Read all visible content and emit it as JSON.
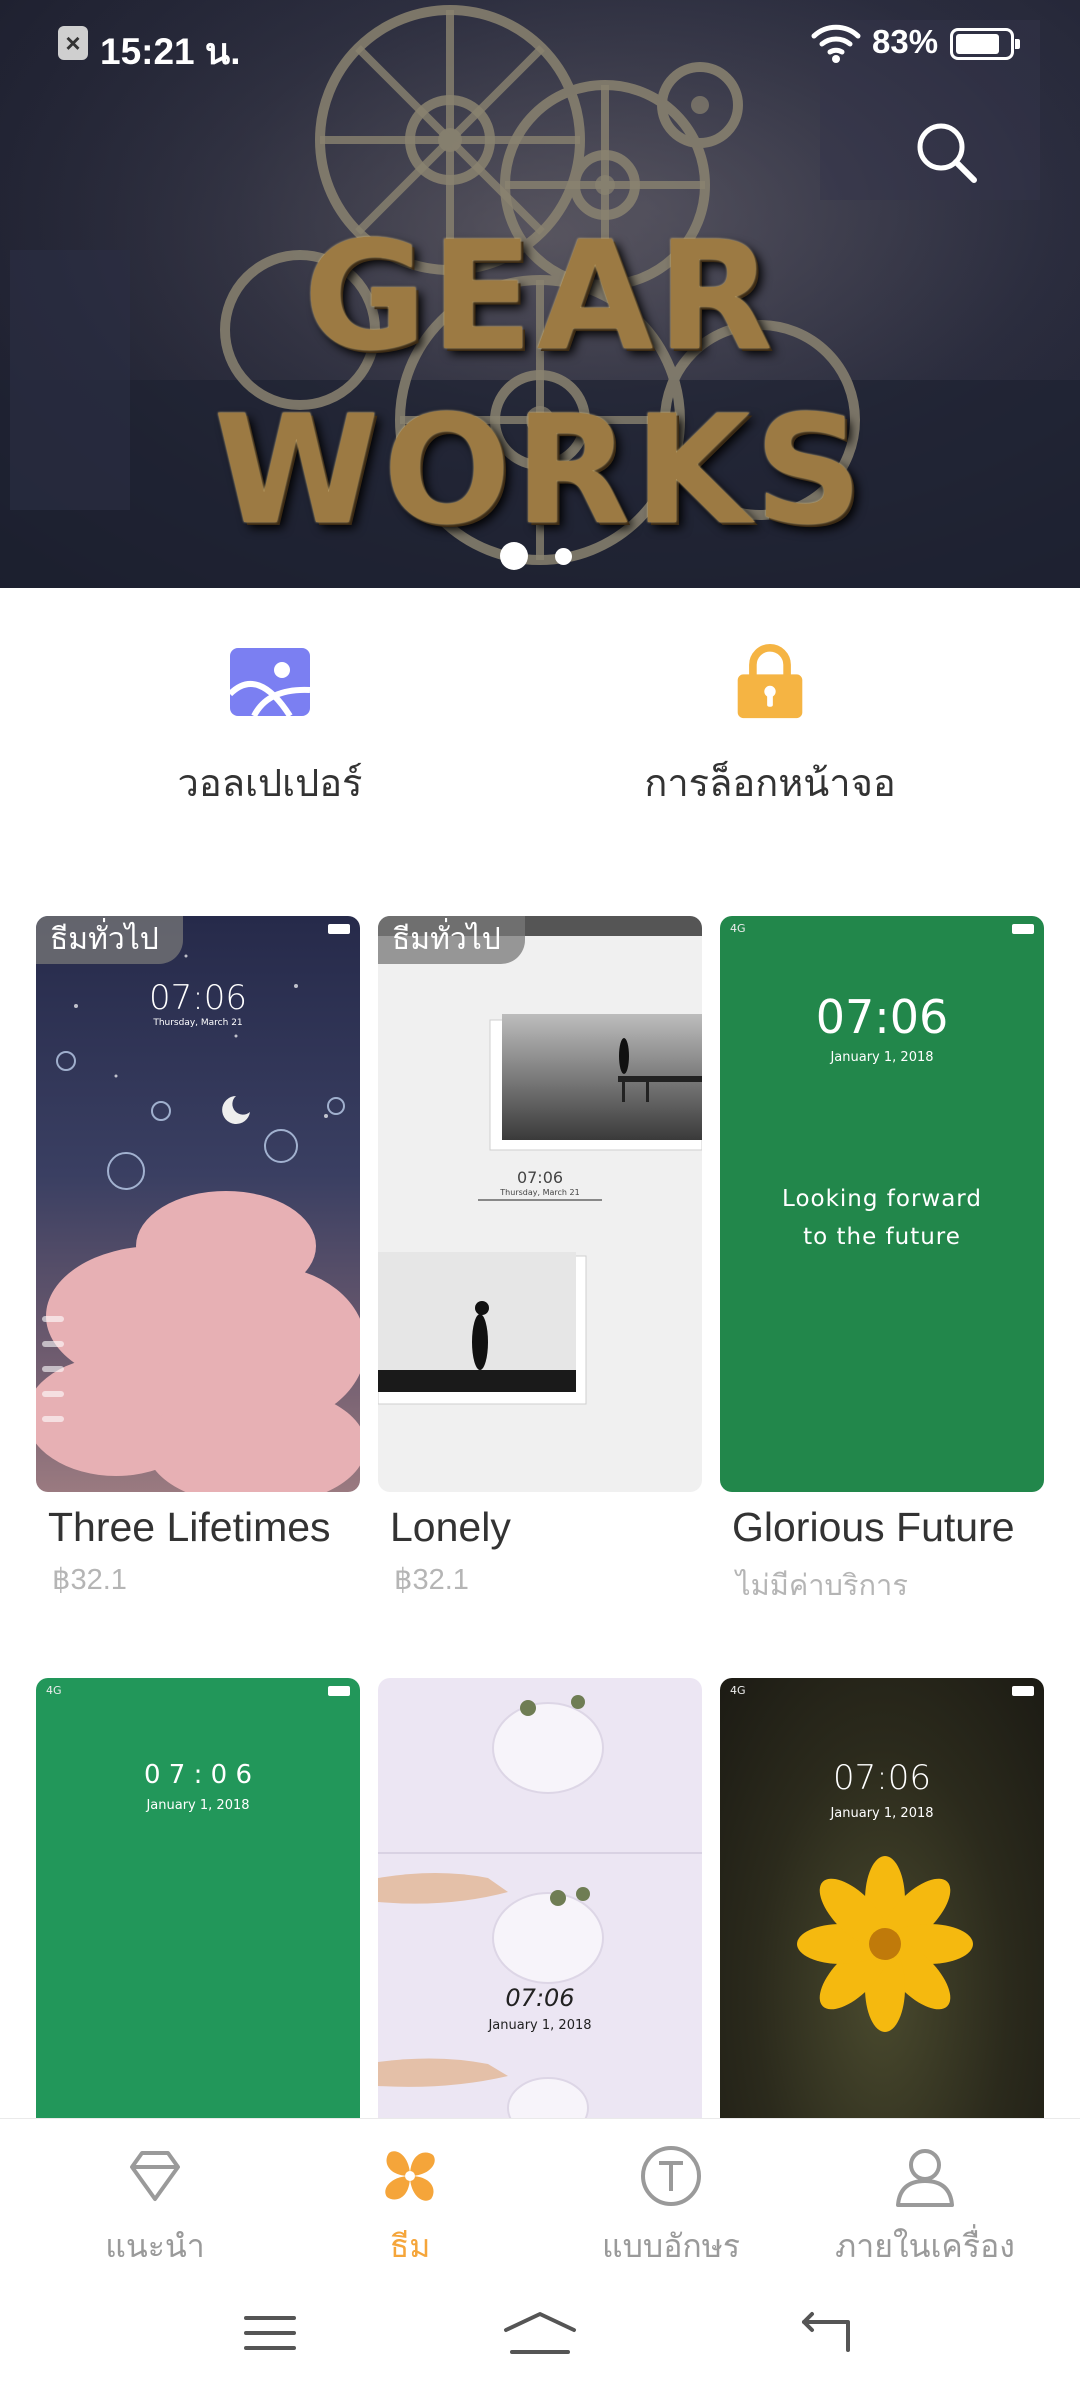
{
  "status_bar": {
    "time": "15:21 น.",
    "battery_percent": "83%",
    "battery_level": 0.83,
    "icons": [
      "notification-x-icon",
      "wifi-icon",
      "battery-icon"
    ]
  },
  "banner": {
    "title": "GEAR WORKS",
    "slide_count": 2,
    "active_slide": 1,
    "search_icon": "search-icon"
  },
  "quick_entries": [
    {
      "label": "วอลเปเปอร์",
      "icon": "wallpaper-icon",
      "color": "#7b7ff2"
    },
    {
      "label": "การล็อกหน้าจอ",
      "icon": "lock-icon",
      "color": "#f5b443"
    }
  ],
  "themes": [
    {
      "tag": "ธีมทั่วไป",
      "name": "Three Lifetimes",
      "price": "฿32.1",
      "clock": "07:06",
      "date": "Thursday, March 21"
    },
    {
      "tag": "ธีมทั่วไป",
      "name": "Lonely",
      "price": "฿32.1",
      "clock": "07:06",
      "date": "Thursday, March 21"
    },
    {
      "tag": "",
      "name": "Glorious Future",
      "price": "ไม่มีค่าบริการ",
      "clock": "07:06",
      "date": "January 1, 2018",
      "message_line1": "Looking forward",
      "message_line2": "to the future"
    },
    {
      "tag": "",
      "name": "",
      "price": "",
      "clock": "0 7 : 0 6",
      "date": "January 1, 2018"
    },
    {
      "tag": "",
      "name": "",
      "price": "",
      "clock": "07:06",
      "date": "January 1, 2018"
    },
    {
      "tag": "",
      "name": "",
      "price": "",
      "clock": "07:06",
      "date": "January 1, 2018"
    }
  ],
  "bottom_nav": [
    {
      "label": "แนะนำ",
      "icon": "diamond-icon",
      "active": false
    },
    {
      "label": "ธีม",
      "icon": "theme-pinwheel-icon",
      "active": true
    },
    {
      "label": "แบบอักษร",
      "icon": "font-icon",
      "active": false
    },
    {
      "label": "ภายในเครื่อง",
      "icon": "person-icon",
      "active": false
    }
  ],
  "colors": {
    "accent": "#f5a53a",
    "inactive_nav": "#9a9a9a",
    "green_theme": "#22874b",
    "wallpaper_icon": "#7b7ff2",
    "lock_icon": "#f5b443"
  },
  "system_nav": [
    "menu-icon",
    "home-icon",
    "back-icon"
  ]
}
